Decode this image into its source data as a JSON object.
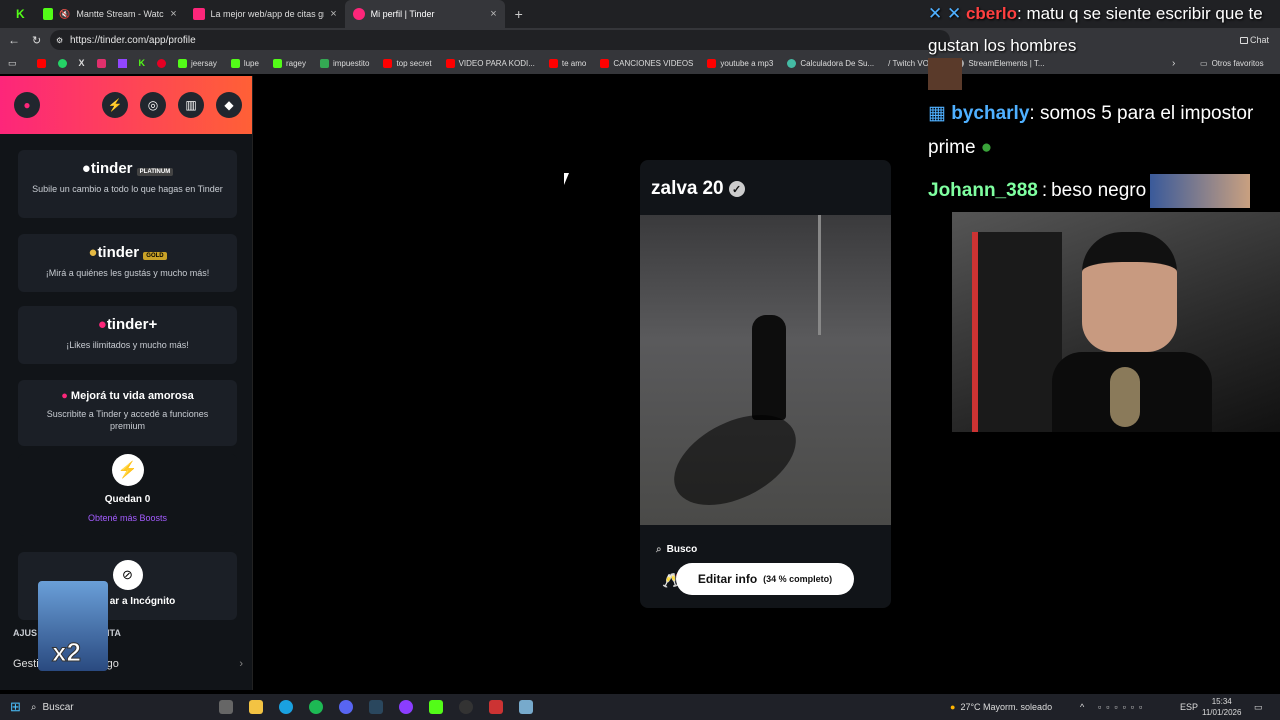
{
  "tabs": [
    {
      "label": "Mantte Stream - Watch Live o",
      "color": "#53fc18"
    },
    {
      "label": "La mejor web/app de citas gratis",
      "color": "#fd267a"
    },
    {
      "label": "Mi perfil | Tinder",
      "color": "#fd267a",
      "active": true
    }
  ],
  "address": {
    "url": "https://tinder.com/app/profile"
  },
  "bookmarks": [
    {
      "label": "jeersay",
      "color": "#53fc18"
    },
    {
      "label": "lupe",
      "color": "#53fc18"
    },
    {
      "label": "ragey",
      "color": "#53fc18"
    },
    {
      "label": "impuestito",
      "color": "#34a853"
    },
    {
      "label": "top secret",
      "color": "#ff0000"
    },
    {
      "label": "VIDEO PARA KODI...",
      "color": "#ff0000"
    },
    {
      "label": "te amo",
      "color": "#ff0000"
    },
    {
      "label": "CANCIONES VIDEOS",
      "color": "#ff0000"
    },
    {
      "label": "youtube a mp3",
      "color": "#ff0000"
    },
    {
      "label": "Calculadora De Su...",
      "color": "#44bba4"
    },
    {
      "label": "/ Twitch VOD...",
      "color": "#9146ff"
    },
    {
      "label": "StreamElements | T...",
      "color": "#ffffff"
    }
  ],
  "bookmarks_other": "Otros favoritos",
  "sidebar": {
    "platinum": {
      "logo": "tinder",
      "badge": "PLATINUM",
      "text": "Subile un cambio a todo lo que hagas en Tinder"
    },
    "gold": {
      "logo": "tinder",
      "badge": "GOLD",
      "text": "¡Mirá a quiénes les gustás y mucho más!"
    },
    "plus": {
      "logo": "tinder+",
      "text": "¡Likes ilimitados y mucho más!"
    },
    "love": {
      "title": "Mejorá tu vida amorosa",
      "text": "Suscribite a Tinder y accedé a funciones premium"
    },
    "boost": {
      "title": "Quedan 0",
      "link": "Obtené más Boosts"
    },
    "incognito": {
      "title": "ar a Incógnito"
    },
    "section": "AJUS",
    "section_tail": "ENTA",
    "payment": "Gestion",
    "payment_tail": "ta de pago",
    "overlay_badge": "x2"
  },
  "profile": {
    "name": "zalva",
    "age": "20",
    "search_label": "Busco",
    "edit_label": "Editar info",
    "completion": "(34 % completo)"
  },
  "chat": [
    {
      "user": "cberlo",
      "msg": "matu q se siente escribir que te gustan los hombres",
      "color": "#ff4040"
    },
    {
      "user": "bycharly",
      "msg": "somos 5 para el impostor prime",
      "color": "#4fb0ff"
    },
    {
      "user": "Johann_388",
      "msg": "beso negro",
      "color": "#7fffa0"
    }
  ],
  "chat_btn": "Chat",
  "taskbar": {
    "search": "Buscar",
    "weather": "27°C  Mayorm. soleado",
    "lang": "ESP",
    "time": "15:34",
    "date": "11/01/2026"
  }
}
